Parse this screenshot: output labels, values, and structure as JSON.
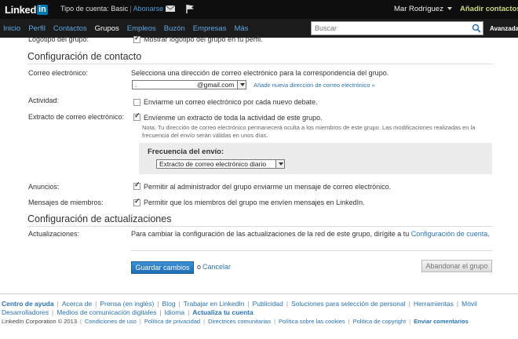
{
  "topbar": {
    "logo_text": "Linked",
    "logo_in": "in",
    "account_type": "Tipo de cuenta: Basic",
    "separator": "|",
    "upgrade_link": "Abonarse",
    "user_name": "Mar Rodríguez",
    "add_contacts": "Añadir contactos"
  },
  "nav": {
    "items": [
      "Inicio",
      "Perfil",
      "Contactos",
      "Grupos",
      "Empleos",
      "Buzón",
      "Empresas",
      "Más"
    ],
    "active": "Grupos",
    "search_placeholder": "Buscar",
    "advanced": "Avanzada"
  },
  "form": {
    "logo_partial_label": "Logotipo del grupo:",
    "logo_partial_text": "Mostrar logotipo del grupo en tu perfil.",
    "contact_section_title": "Configuración de contacto",
    "email_label": "Correo electrónico:",
    "email_help": "Selecciona una dirección de correo electrónico para la correspondencia del grupo.",
    "email_value": "@gmail.com",
    "email_value_prefix": ".",
    "add_email_link": "Añadir nueva dirección de correo electrónico »",
    "activity_label": "Actividad:",
    "activity_text": "Enviarme un correo electrónico por cada nuevo debate.",
    "digest_label": "Extracto de correo electrónico:",
    "digest_text": "Envíenme un extracto de toda la actividad de este grupo.",
    "digest_note": "Nota: Tu dirección de correo electrónico permanecerá oculta a los miembros de este grupo. Las modificaciones realizadas en la frecuencia del envío serán válidas en unos días.",
    "frequency_label": "Frecuencia del envío:",
    "frequency_value": "Extracto de correo electrónico diario",
    "announcements_label": "Anuncios:",
    "announcements_text": "Permitir al administrador del grupo enviarme un mensaje de correo electrónico.",
    "member_messages_label": "Mensajes de miembros:",
    "member_messages_text": "Permitir que los miembros del grupo me envíen mensajes en LinkedIn.",
    "updates_section_title": "Configuración de actualizaciones",
    "updates_label": "Actualizaciones:",
    "updates_text": "Para cambiar la configuración de las actualizaciones de la red de este grupo, dirígite a tu",
    "updates_link": "Configuración de cuenta",
    "updates_period": ".",
    "save_button": "Guardar cambios",
    "or_text": "o",
    "cancel_link": "Cancelar",
    "leave_button": "Abandonar el grupo",
    "checkboxes": {
      "logo": true,
      "activity": false,
      "digest": true,
      "announcements": true,
      "member_messages": true
    }
  },
  "footer": {
    "links": [
      "Centro de ayuda",
      "Acerca de",
      "Prensa (en inglés)",
      "Blog",
      "Trabajar en LinkedIn",
      "Publicidad",
      "Soluciones para selección de personal",
      "Herramientas",
      "Móvil",
      "Desarrolladores",
      "Medios de comunicación digitales",
      "Idioma",
      "Actualiza tu cuenta"
    ],
    "copyright": "LinkedIn Corporation © 2013",
    "bottom_links": [
      "Condiciones de uso",
      "Política de privacidad",
      "Directrices comunitarias",
      "Política sobre las cookies",
      "Política de copyright",
      "Enviar comentarios"
    ]
  },
  "colors": {
    "topbar_bg": "#0e0e0e",
    "nav_bg": "#1b1b1b",
    "link": "#2a73b6",
    "add_contacts": "#c7d97b",
    "primary_button": "#1f6fb5"
  }
}
